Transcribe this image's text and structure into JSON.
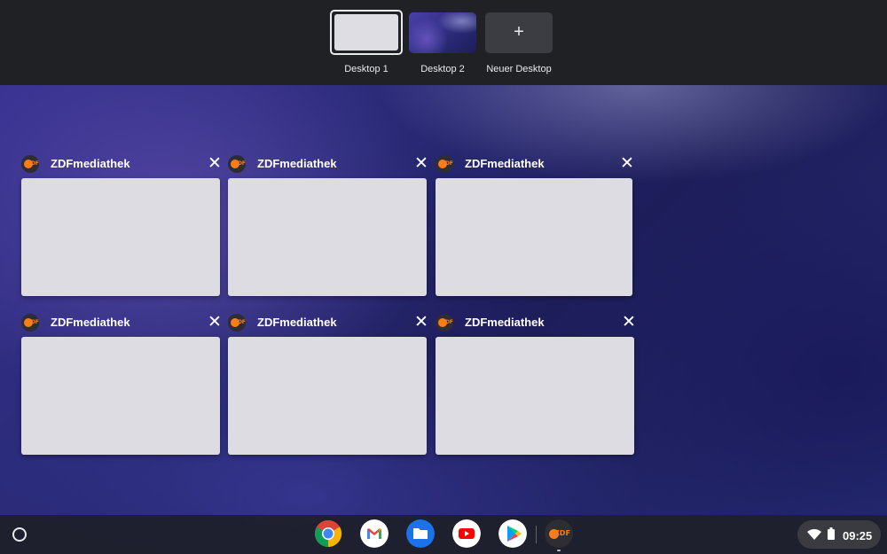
{
  "desks": [
    {
      "label": "Desktop 1",
      "active": true
    },
    {
      "label": "Desktop 2",
      "active": false
    },
    {
      "label": "Neuer Desktop",
      "icon": "+"
    }
  ],
  "windows": [
    {
      "title": "ZDFmediathek",
      "close": "✕",
      "icon": "zdf-icon"
    },
    {
      "title": "ZDFmediathek",
      "close": "✕",
      "icon": "zdf-icon"
    },
    {
      "title": "ZDFmediathek",
      "close": "✕",
      "icon": "zdf-icon"
    },
    {
      "title": "ZDFmediathek",
      "close": "✕",
      "icon": "zdf-icon"
    },
    {
      "title": "ZDFmediathek",
      "close": "✕",
      "icon": "zdf-icon"
    },
    {
      "title": "ZDFmediathek",
      "close": "✕",
      "icon": "zdf-icon"
    }
  ],
  "zdf_logo_text": "ZDF",
  "shelf": {
    "apps": [
      "chrome-icon",
      "gmail-icon",
      "files-icon",
      "youtube-icon",
      "play-store-icon",
      "zdf-icon"
    ],
    "time": "09:25"
  },
  "colors": {
    "desk_bar": "#202124",
    "window_preview": "#dcdce2",
    "zdf_orange": "#fa7d19",
    "shelf": "#1e2028"
  }
}
